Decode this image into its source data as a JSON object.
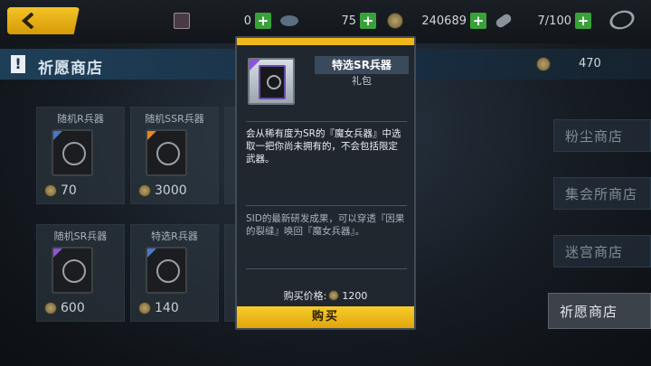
{
  "topbar": {
    "resources": [
      {
        "icon": "card-pack-icon",
        "value": "0"
      },
      {
        "icon": "crystal-icon",
        "value": "75"
      },
      {
        "icon": "gold-coin-icon",
        "value": "240689"
      },
      {
        "icon": "stamina-capsule-icon",
        "value": "7/100"
      }
    ]
  },
  "shop": {
    "title": "祈愿商店",
    "currency_amount": "470"
  },
  "cards": [
    {
      "name": "随机R兵器",
      "price": "70",
      "rarity_color": "#4a78c8"
    },
    {
      "name": "随机SSR兵器",
      "price": "3000",
      "rarity_color": "#e08a1e"
    },
    {
      "name": "随机SR兵器",
      "price": "600",
      "rarity_color": "#8a55d6"
    },
    {
      "name": "特选R兵器",
      "price": "140",
      "rarity_color": "#4a78c8"
    }
  ],
  "nav": {
    "items": [
      "粉尘商店",
      "集会所商店",
      "迷宫商店",
      "祈愿商店"
    ],
    "active_index": 3
  },
  "dialog": {
    "item_name": "特选SR兵器",
    "item_type": "礼包",
    "description": "会从稀有度为SR的『魔女兵器』中选取一把你尚未拥有的，不会包括限定武器。",
    "lore": "SID的最新研发成果，可以穿透『因果的裂缝』唤回『魔女兵器』。",
    "price_label": "购买价格:",
    "price": "1200",
    "buy_label": "购买"
  },
  "colors": {
    "accent_yellow": "#f0b81b",
    "plus_green": "#3aa13a",
    "sr_purple": "#8a55d6"
  }
}
